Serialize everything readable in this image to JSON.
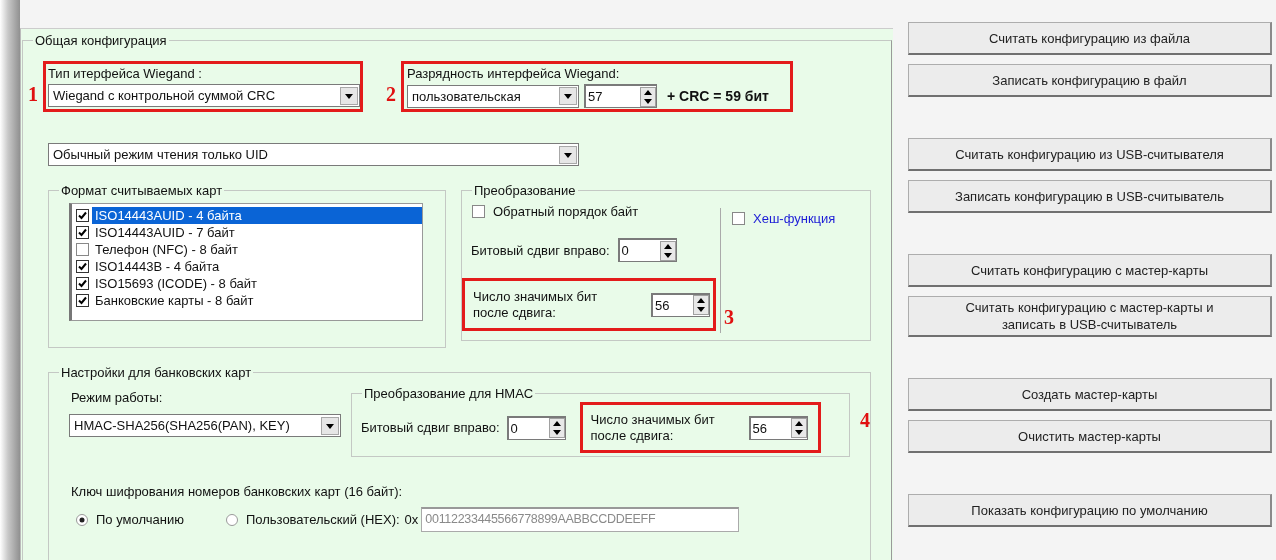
{
  "general": {
    "title": "Общая конфигурация",
    "wiegand_type": {
      "callout": "1",
      "label": "Тип итерфейса Wiegand :",
      "value": "Wiegand с контрольной суммой CRC"
    },
    "wiegand_width": {
      "callout": "2",
      "label": "Разрядность интерфейса Wiegand:",
      "mode": "пользовательская",
      "bits": "57",
      "total": "+ CRC = 59 бит"
    },
    "read_mode": "Обычный режим чтения только UID",
    "card_formats": {
      "title": "Формат считываемых карт",
      "items": [
        {
          "label": "ISO14443AUID - 4 байта",
          "checked": true,
          "selected": true
        },
        {
          "label": "ISO14443AUID - 7 байт",
          "checked": true,
          "selected": false
        },
        {
          "label": "Телефон (NFC) - 8 байт",
          "checked": false,
          "selected": false
        },
        {
          "label": "ISO14443B - 4 байта",
          "checked": true,
          "selected": false
        },
        {
          "label": "ISO15693 (ICODE) - 8 байт",
          "checked": true,
          "selected": false
        },
        {
          "label": "Банковские карты - 8 байт",
          "checked": true,
          "selected": false
        }
      ]
    },
    "transform": {
      "title": "Преобразование",
      "reverse_bytes": {
        "label": "Обратный порядок байт",
        "checked": false
      },
      "hash": {
        "label": "Хеш-функция",
        "checked": false
      },
      "shift_label": "Битовый сдвиг вправо:",
      "shift": "0",
      "callout": "3",
      "significant_label": "Число значимых бит после сдвига:",
      "significant": "56"
    },
    "bank": {
      "title": "Настройки для банковских карт",
      "mode_label": "Режим работы:",
      "mode": "HMAC-SHA256(SHA256(PAN), KEY)",
      "hmac": {
        "title": "Преобразование для HMAC",
        "shift_label": "Битовый сдвиг вправо:",
        "shift": "0",
        "callout": "4",
        "significant_label": "Число значимых бит после сдвига:",
        "significant": "56"
      },
      "key_label": "Ключ шифрования номеров банковских карт (16 байт):",
      "key_options": [
        {
          "label": "По умолчанию",
          "selected": true
        },
        {
          "label": "Пользовательский (HEX):",
          "selected": false
        }
      ],
      "hex_prefix": "0x",
      "hex_field": {
        "value": "00112233445566778899AABBCCDDEEFF",
        "disabled": true
      }
    }
  },
  "button_groups": [
    [
      "Считать конфигурацию из файла",
      "Записать конфигурацию в файл"
    ],
    [
      "Считать конфигурацию из USB-считывателя",
      "Записать конфигурацию в USB-считыватель"
    ],
    [
      "Считать конфигурацию с мастер-карты",
      "Считать конфигурацию с мастер-карты и записать в USB-считыватель"
    ],
    [
      "Создать мастер-карты",
      "Очистить мастер-карты"
    ],
    [
      "Показать конфигурацию по умолчанию"
    ]
  ]
}
